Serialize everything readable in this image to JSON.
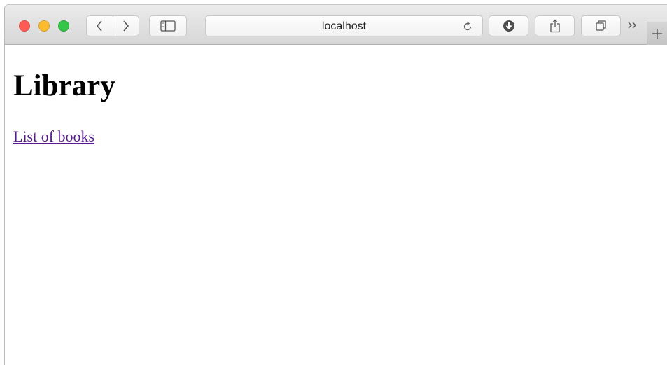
{
  "browser": {
    "address": "localhost",
    "icons": {
      "back": "chevron-left-icon",
      "forward": "chevron-right-icon",
      "sidebar": "sidebar-icon",
      "reload": "reload-icon",
      "downloads": "download-icon",
      "share": "share-icon",
      "tabs": "tabs-icon",
      "overflow": "double-chevron-icon",
      "new_tab": "plus-icon"
    },
    "colors": {
      "close": "#fc5c54",
      "minimize": "#fdbb2f",
      "maximize": "#34c649"
    }
  },
  "page": {
    "heading": "Library",
    "link_text": "List of books",
    "link_color": "#551a8b"
  }
}
